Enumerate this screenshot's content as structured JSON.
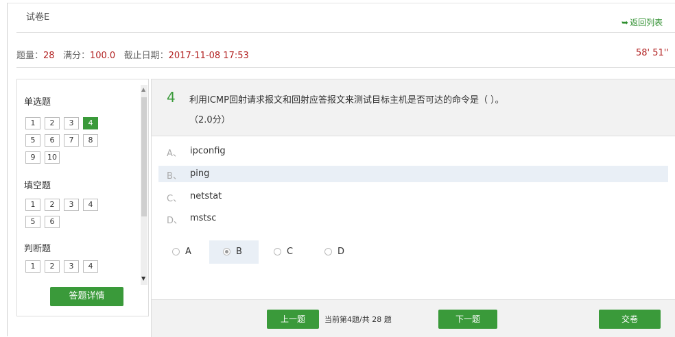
{
  "header": {
    "title": "试卷E",
    "back_label": "返回列表",
    "timer": "58' 51''"
  },
  "info": {
    "count_label": "题量：",
    "count_value": "28",
    "score_label": "满分：",
    "score_value": "100.0",
    "deadline_label": "截止日期：",
    "deadline_value": "2017-11-08 17:53"
  },
  "nav": {
    "sections": [
      {
        "title": "单选题",
        "items": [
          "1",
          "2",
          "3",
          "4",
          "5",
          "6",
          "7",
          "8",
          "9",
          "10"
        ]
      },
      {
        "title": "填空题",
        "items": [
          "1",
          "2",
          "3",
          "4",
          "5",
          "6"
        ]
      },
      {
        "title": "判断题",
        "items": [
          "1",
          "2",
          "3",
          "4"
        ]
      }
    ],
    "current": "4",
    "detail_label": "答题详情"
  },
  "question": {
    "number": "4",
    "text": "利用ICMP回射请求报文和回射应答报文来测试目标主机是否可达的命令是（ ）。",
    "score": "（2.0分）",
    "options": [
      {
        "letter": "A、",
        "text": "ipconfig"
      },
      {
        "letter": "B、",
        "text": "ping"
      },
      {
        "letter": "C、",
        "text": "netstat"
      },
      {
        "letter": "D、",
        "text": "mstsc"
      }
    ],
    "choices": [
      "A",
      "B",
      "C",
      "D"
    ],
    "selected": "B"
  },
  "footer": {
    "prev_label": "上一题",
    "progress": "当前第4题/共 28 题",
    "next_label": "下一题",
    "submit_label": "交卷"
  }
}
